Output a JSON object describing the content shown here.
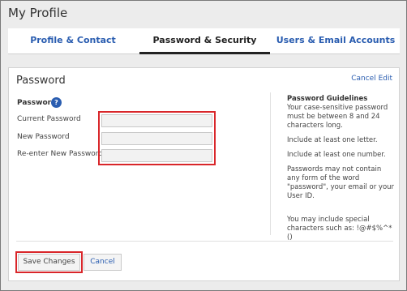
{
  "page": {
    "title": "My Profile"
  },
  "tabs": [
    {
      "label": "Profile & Contact",
      "active": false
    },
    {
      "label": "Password & Security",
      "active": true
    },
    {
      "label": "Users & Email Accounts",
      "active": false
    }
  ],
  "panel": {
    "title": "Password",
    "cancel_edit": "Cancel Edit",
    "section_label": "Password",
    "help_icon": "?",
    "fields": [
      {
        "label": "Current Password",
        "value": "",
        "placeholder": ""
      },
      {
        "label": "New Password",
        "value": "",
        "placeholder": ""
      },
      {
        "label": "Re-enter New Password",
        "value": "",
        "placeholder": ""
      }
    ]
  },
  "guidelines": {
    "title": "Password Guidelines",
    "lines": [
      "Your case-sensitive password must be between 8 and 24 characters long.",
      "Include at least one letter.",
      "Include at least one number.",
      "Passwords may not contain any form of the word \"password\", your email or your User ID."
    ],
    "special": "You may include special characters such as: !@#$%^*()"
  },
  "buttons": {
    "save": "Save Changes",
    "cancel": "Cancel"
  },
  "colors": {
    "link": "#2a5db0",
    "highlight": "#d9262a",
    "help_icon": "#2a5db0"
  }
}
